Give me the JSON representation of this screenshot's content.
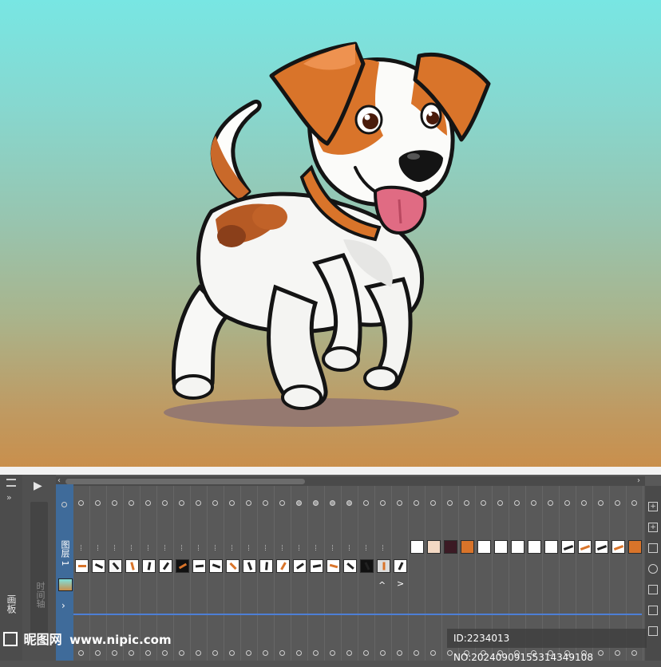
{
  "timeline": {
    "layer_label": "图层 1",
    "frame_count": 34,
    "nav_prev": "‹",
    "nav_next": "›",
    "play_icon": "▶",
    "ctrl_up": "^",
    "ctrl_next": ">"
  },
  "left_panel": {
    "panel_label": "画板",
    "side_label": "时间轴"
  },
  "watermark": {
    "brand": "昵图网",
    "url": "www.nipic.com"
  },
  "image_id": "ID:2234013 NO:20240909155314349108",
  "colors": {
    "sky_top": "#78e6e3",
    "ground_bottom": "#c98f4c",
    "dog_orange": "#d9742a",
    "timeline_blue": "#4d7fd6",
    "layer_blue": "#3f6b9a"
  }
}
